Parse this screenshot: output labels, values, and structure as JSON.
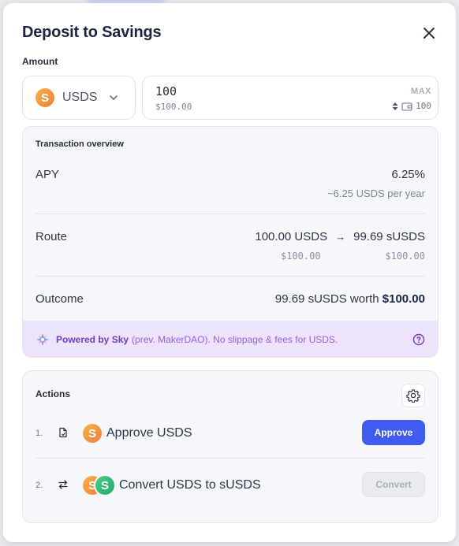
{
  "dialog": {
    "title": "Deposit to Savings"
  },
  "amount": {
    "label": "Amount",
    "token": "USDS",
    "value": "100",
    "usd_value": "$100.00",
    "max_label": "MAX",
    "balance": "100"
  },
  "overview": {
    "title": "Transaction overview",
    "apy_label": "APY",
    "apy_value": "6.25%",
    "apy_sub": "~6.25 USDS per year",
    "route_label": "Route",
    "route_from": "100.00 USDS",
    "route_arrow": "→",
    "route_to": "99.69 sUSDS",
    "route_from_usd": "$100.00",
    "route_to_usd": "$100.00",
    "outcome_label": "Outcome",
    "outcome_prefix": "99.69 sUSDS worth ",
    "outcome_value": "$100.00",
    "powered_bold": "Powered by Sky",
    "powered_rest": "(prev. MakerDAO). No slippage & fees for USDS."
  },
  "actions": {
    "title": "Actions",
    "steps": [
      {
        "num": "1.",
        "label": "Approve USDS",
        "button": "Approve"
      },
      {
        "num": "2.",
        "label": "Convert USDS to sUSDS",
        "button": "Convert"
      }
    ]
  },
  "colors": {
    "primary_button": "#3f5bf0",
    "powered_bg": "#ede3fb",
    "powered_text": "#6c3fc4"
  },
  "icons": {
    "close": "close-icon",
    "chevron": "chevron-down-icon",
    "wallet": "wallet-icon",
    "sky": "sky-logo-icon",
    "help": "help-circle-icon",
    "settings": "gear-icon",
    "approve_step": "document-icon",
    "convert_step": "swap-arrows-icon"
  }
}
